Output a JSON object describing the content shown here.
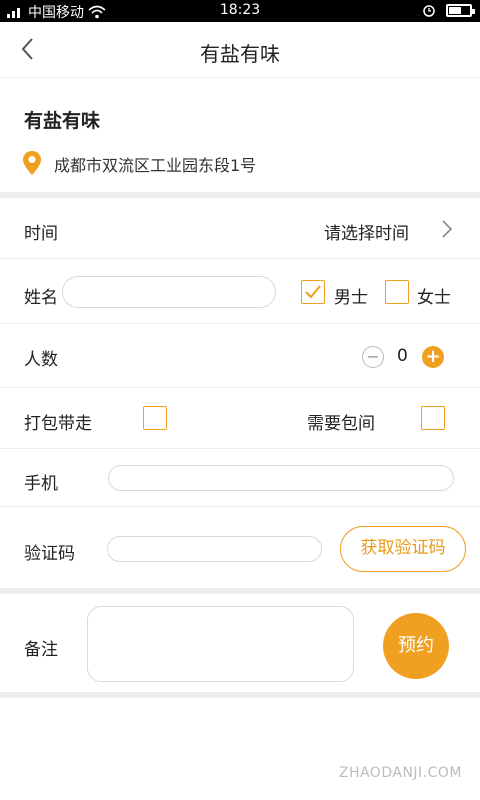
{
  "status_bar": {
    "carrier": "中国移动",
    "time": "18:23"
  },
  "header": {
    "title": "有盐有味"
  },
  "shop": {
    "name": "有盐有味",
    "address": "成都市双流区工业园东段1号"
  },
  "form": {
    "time_label": "时间",
    "time_value": "请选择时间",
    "name_label": "姓名",
    "name_value": "",
    "gender_male": "男士",
    "gender_female": "女士",
    "gender_selected": "男士",
    "people_label": "人数",
    "people_count": "0",
    "takeaway_label": "打包带走",
    "room_label": "需要包间",
    "phone_label": "手机",
    "code_label": "验证码",
    "get_code_button": "获取验证码",
    "notes_label": "备注",
    "book_button": "预约"
  },
  "watermark": "ZHAODANJI.COM",
  "colors": {
    "accent": "#f0a020",
    "divider": "#ededed"
  }
}
